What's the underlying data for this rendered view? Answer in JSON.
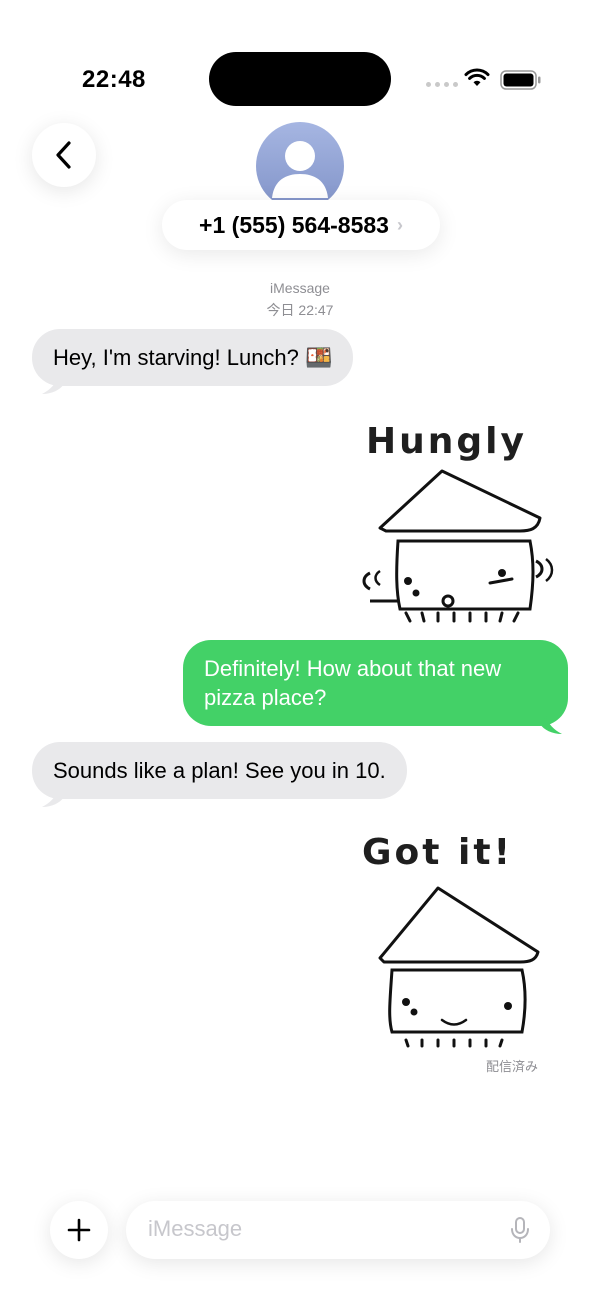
{
  "status_bar": {
    "time": "22:48"
  },
  "header": {
    "contact": "+1 (555) 564-8583",
    "chevron": "›"
  },
  "conversation": {
    "service": "iMessage",
    "timestamp": "今日 22:47",
    "messages": [
      {
        "direction": "in",
        "text": "Hey, I'm starving! Lunch? 🍱"
      },
      {
        "direction": "out",
        "type": "sticker",
        "caption": "Hungly"
      },
      {
        "direction": "out",
        "text": "Definitely! How about that new pizza place?"
      },
      {
        "direction": "in",
        "text": "Sounds like a plan! See you in 10."
      },
      {
        "direction": "out",
        "type": "sticker",
        "caption": "Got it!"
      }
    ],
    "delivered": "配信済み"
  },
  "composer": {
    "placeholder": "iMessage"
  },
  "colors": {
    "outgoing_bubble": "#43d167",
    "incoming_bubble": "#e9e9eb",
    "secondary_text": "#8e8e93"
  },
  "icons": [
    "back-chevron-icon",
    "person-icon",
    "wifi-icon",
    "battery-icon",
    "plus-icon",
    "mic-icon",
    "cellular-icon"
  ]
}
